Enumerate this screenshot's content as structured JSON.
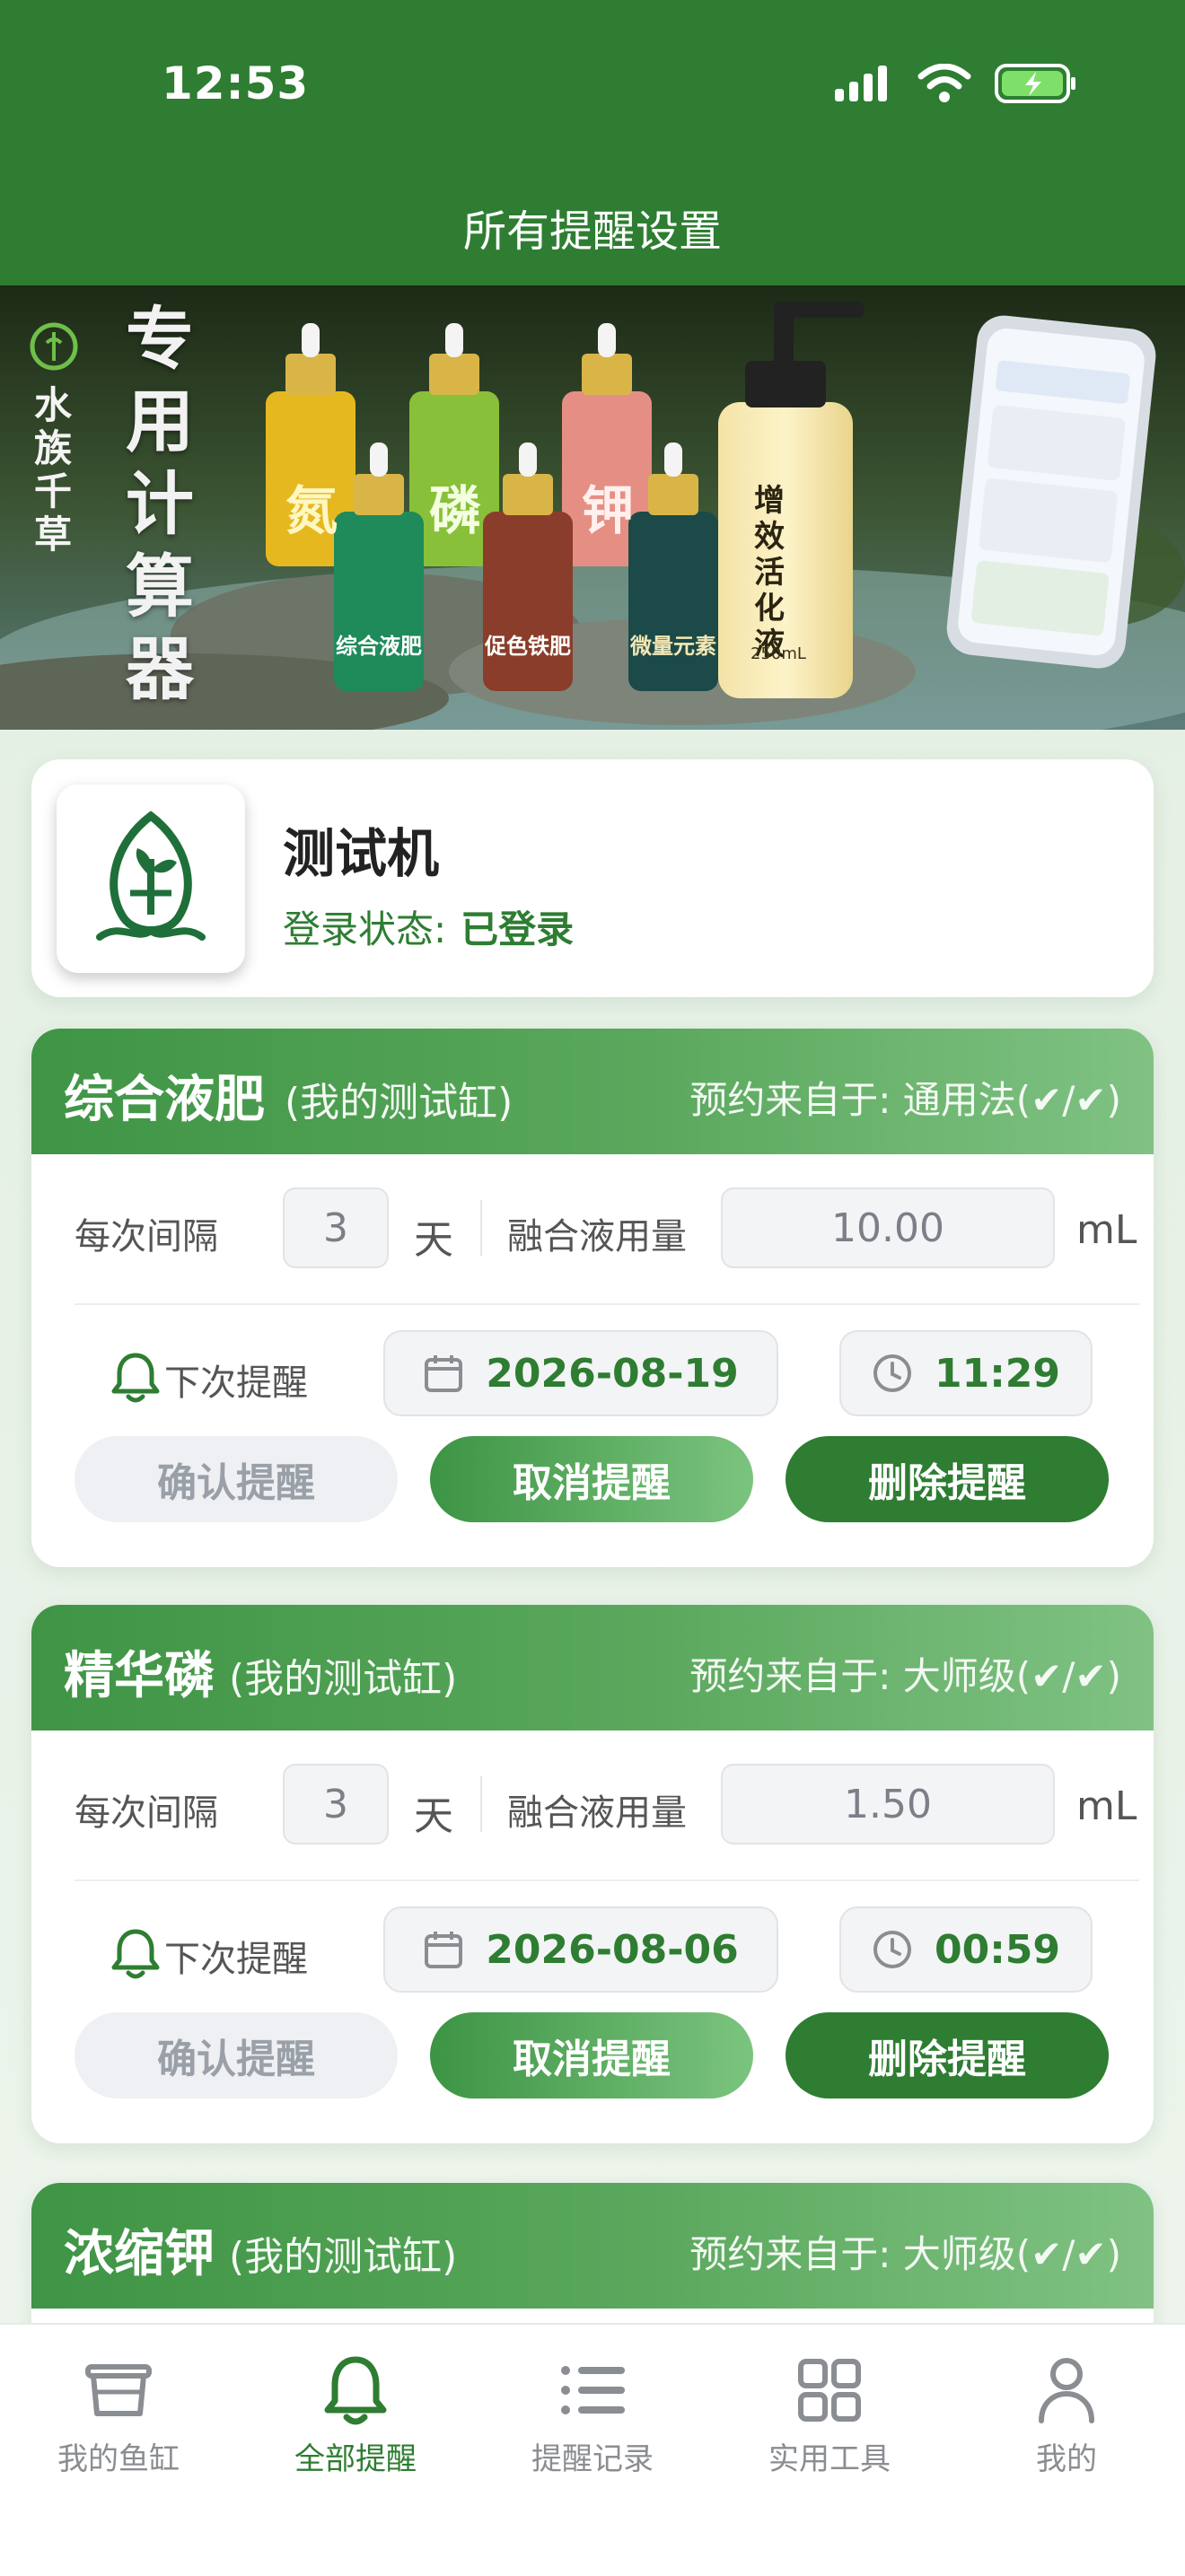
{
  "status_bar": {
    "time": "12:53"
  },
  "header": {
    "title": "所有提醒设置"
  },
  "banner": {
    "brand": "水族千草",
    "headline": "专用计算器",
    "bottles": [
      "氮",
      "磷",
      "钾",
      "综合液肥",
      "促色铁肥",
      "微量元素"
    ],
    "pump_bottle": "增效活化液",
    "pump_volume": "250mL"
  },
  "profile": {
    "name": "测试机",
    "login_label": "登录状态:",
    "login_value": "已登录"
  },
  "labels": {
    "interval": "每次间隔",
    "day_unit": "天",
    "dosage": "融合液用量",
    "ml_unit": "mL",
    "next": "下次提醒",
    "confirm": "确认提醒",
    "cancel": "取消提醒",
    "delete": "删除提醒"
  },
  "reminders": [
    {
      "name": "综合液肥",
      "tank": "(我的测试缸)",
      "source": "预约来自于: 通用法(✔/✔)",
      "interval": "3",
      "dose": "10.00",
      "date": "2026-08-19",
      "time": "11:29"
    },
    {
      "name": "精华磷",
      "tank": "(我的测试缸)",
      "source": "预约来自于: 大师级(✔/✔)",
      "interval": "3",
      "dose": "1.50",
      "date": "2026-08-06",
      "time": "00:59"
    },
    {
      "name": "浓缩钾",
      "tank": "(我的测试缸)",
      "source": "预约来自于: 大师级(✔/✔)"
    }
  ],
  "tabbar": {
    "items": [
      {
        "label": "我的鱼缸",
        "icon": "fish-tank-icon"
      },
      {
        "label": "全部提醒",
        "icon": "bell-icon"
      },
      {
        "label": "提醒记录",
        "icon": "list-icon"
      },
      {
        "label": "实用工具",
        "icon": "grid-icon"
      },
      {
        "label": "我的",
        "icon": "user-icon"
      }
    ],
    "active": "全部提醒"
  },
  "colors": {
    "primary": "#2e7d32",
    "accent": "#7bc47f",
    "background": "#e6f0e5"
  }
}
